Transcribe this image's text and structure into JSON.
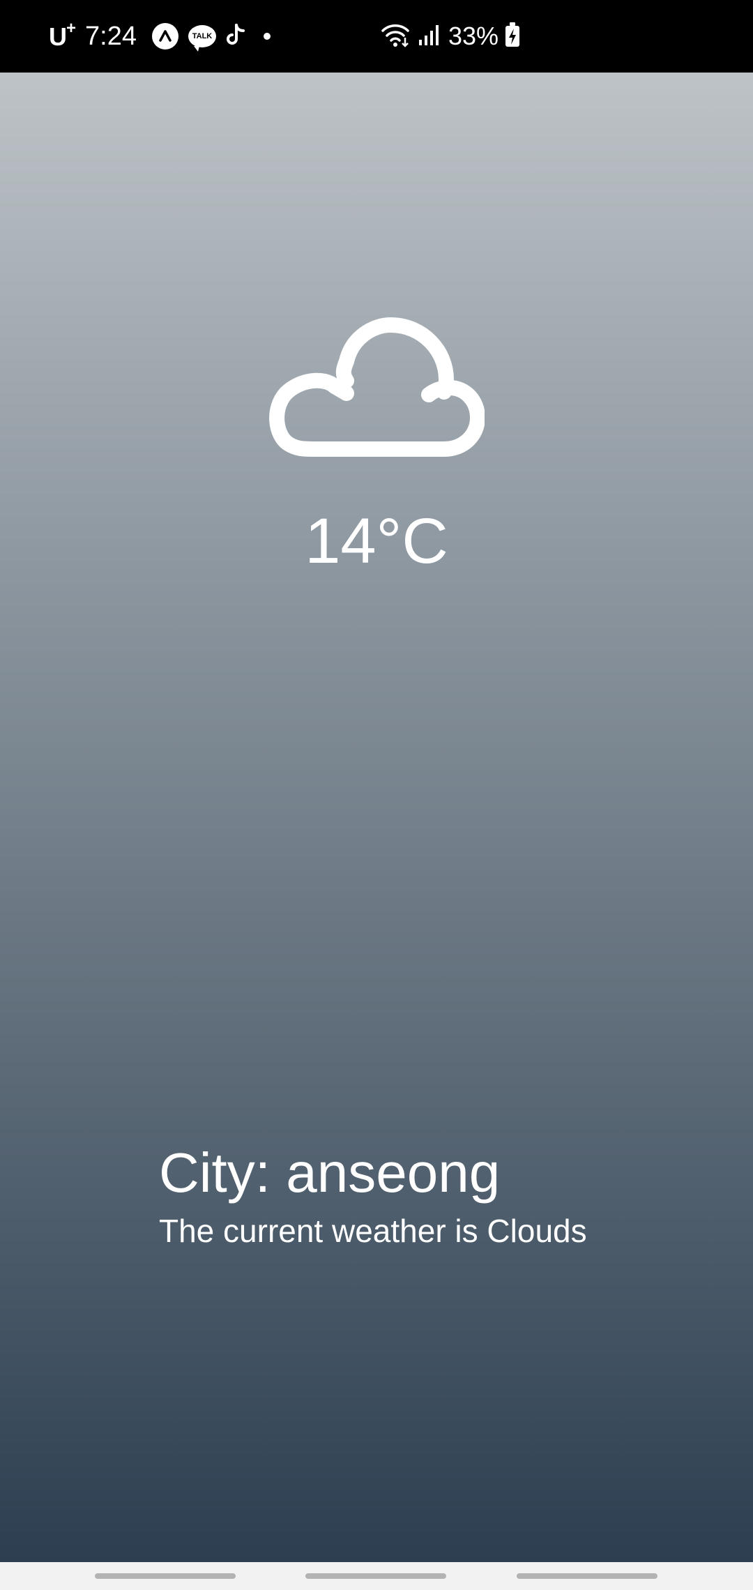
{
  "status_bar": {
    "carrier": "U",
    "carrier_plus": "+",
    "time": "7:24",
    "notification_icons": [
      "arrow-app-icon",
      "kakaotalk-icon",
      "tiktok-icon",
      "more-dot-icon"
    ],
    "talk_label": "TALK",
    "battery_percent": "33%",
    "system_icons": [
      "wifi-icon",
      "signal-icon",
      "battery-charging-icon"
    ]
  },
  "weather": {
    "condition_icon": "cloud-icon",
    "temperature": "14°C",
    "city_line": "City: anseong",
    "description": "The current weather is Clouds"
  },
  "theme": {
    "gradient_top": "#bdc3c7",
    "gradient_bottom": "#2c3e50",
    "text_color": "#ffffff"
  }
}
